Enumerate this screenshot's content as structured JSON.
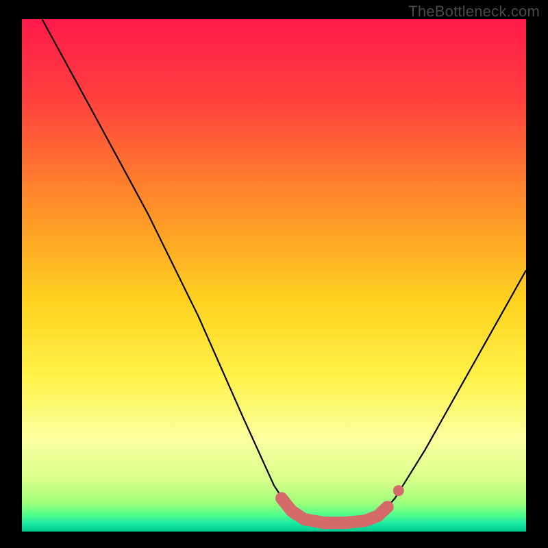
{
  "watermark": "TheBottleneck.com",
  "chart_data": {
    "type": "line",
    "title": "",
    "xlabel": "",
    "ylabel": "",
    "xlim": [
      0,
      100
    ],
    "ylim": [
      0,
      100
    ],
    "grid": false,
    "legend": false,
    "background_gradient_stops": [
      {
        "offset": 0.0,
        "color": "#ff1a4b"
      },
      {
        "offset": 0.15,
        "color": "#ff3e3e"
      },
      {
        "offset": 0.35,
        "color": "#ff8a2a"
      },
      {
        "offset": 0.55,
        "color": "#ffd21f"
      },
      {
        "offset": 0.7,
        "color": "#fff249"
      },
      {
        "offset": 0.82,
        "color": "#fbffa0"
      },
      {
        "offset": 0.9,
        "color": "#d7ff8a"
      },
      {
        "offset": 0.945,
        "color": "#9dff7a"
      },
      {
        "offset": 0.965,
        "color": "#5aff8a"
      },
      {
        "offset": 0.985,
        "color": "#17e8a0"
      },
      {
        "offset": 1.0,
        "color": "#00c98d"
      }
    ],
    "series": [
      {
        "name": "bottleneck-curve",
        "stroke": "#000000",
        "points": [
          {
            "x": 4.0,
            "y": 100.0
          },
          {
            "x": 14.0,
            "y": 82.0
          },
          {
            "x": 25.0,
            "y": 62.0
          },
          {
            "x": 35.0,
            "y": 42.0
          },
          {
            "x": 44.0,
            "y": 22.0
          },
          {
            "x": 50.0,
            "y": 9.0
          },
          {
            "x": 53.0,
            "y": 4.5
          },
          {
            "x": 56.0,
            "y": 2.3
          },
          {
            "x": 60.0,
            "y": 1.6
          },
          {
            "x": 64.0,
            "y": 1.6
          },
          {
            "x": 68.0,
            "y": 2.0
          },
          {
            "x": 71.0,
            "y": 3.2
          },
          {
            "x": 74.0,
            "y": 6.5
          },
          {
            "x": 80.0,
            "y": 16.0
          },
          {
            "x": 88.0,
            "y": 30.0
          },
          {
            "x": 96.0,
            "y": 44.0
          },
          {
            "x": 100.0,
            "y": 51.0
          }
        ]
      }
    ],
    "highlight_band": {
      "name": "optimal-range",
      "color": "#d46a6a",
      "points": [
        {
          "x": 51.5,
          "y": 6.5
        },
        {
          "x": 53.5,
          "y": 4.0
        },
        {
          "x": 56.0,
          "y": 2.4
        },
        {
          "x": 60.0,
          "y": 1.7
        },
        {
          "x": 64.0,
          "y": 1.7
        },
        {
          "x": 68.0,
          "y": 2.1
        },
        {
          "x": 70.5,
          "y": 3.0
        },
        {
          "x": 72.5,
          "y": 4.8
        }
      ],
      "extra_marker": {
        "x": 74.7,
        "y": 8.0
      }
    }
  }
}
